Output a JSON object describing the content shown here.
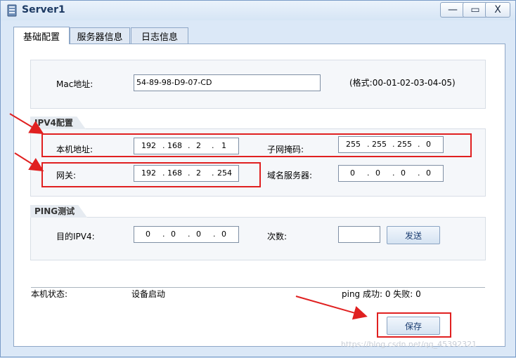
{
  "window": {
    "title": "Server1",
    "icon": "server-icon",
    "controls": {
      "minimize": "—",
      "maximize": "▭",
      "close": "X"
    }
  },
  "tabs": [
    {
      "label": "基础配置",
      "active": true
    },
    {
      "label": "服务器信息",
      "active": false
    },
    {
      "label": "日志信息",
      "active": false
    }
  ],
  "mac": {
    "label": "Mac地址:",
    "value": "54-89-98-D9-07-CD",
    "format_hint": "(格式:00-01-02-03-04-05)"
  },
  "ipv4": {
    "legend": "IPV4配置",
    "host_ip_label": "本机地址:",
    "host_ip": [
      "192",
      "168",
      "2",
      "1"
    ],
    "subnet_label": "子网掩码:",
    "subnet": [
      "255",
      "255",
      "255",
      "0"
    ],
    "gateway_label": "网关:",
    "gateway": [
      "192",
      "168",
      "2",
      "254"
    ],
    "dns_label": "域名服务器:",
    "dns": [
      "0",
      "0",
      "0",
      "0"
    ]
  },
  "ping": {
    "legend": "PING测试",
    "target_label": "目的IPV4:",
    "target": [
      "0",
      "0",
      "0",
      "0"
    ],
    "count_label": "次数:",
    "count_value": "",
    "send_label": "发送"
  },
  "status": {
    "label": "本机状态:",
    "value": "设备启动",
    "ping_result": "ping 成功: 0 失败: 0"
  },
  "save_label": "保存",
  "watermark": "https://blog.csdn.net/qq_45392321",
  "colors": {
    "annotation": "#e02020",
    "title": "#1d3a63"
  }
}
